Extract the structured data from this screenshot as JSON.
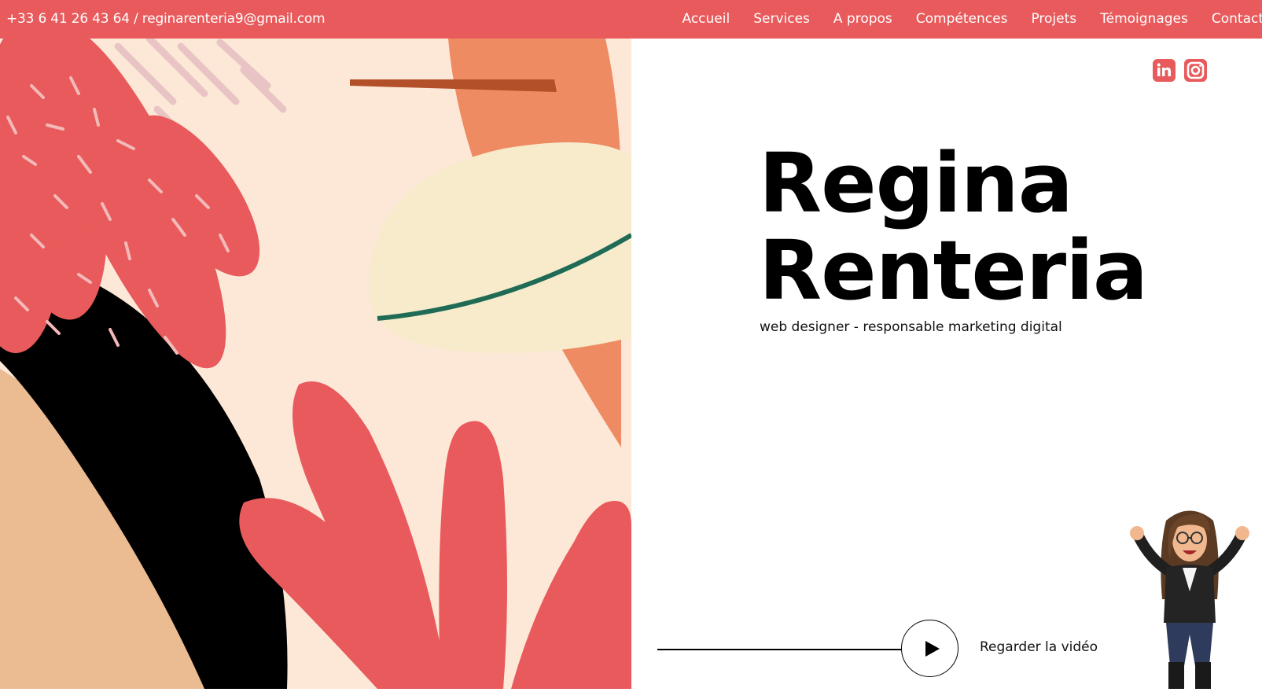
{
  "topbar": {
    "contact": "+33 6 41 26 43 64 / reginarenteria9@gmail.com",
    "nav": [
      "Accueil",
      "Services",
      "A propos",
      "Compétences",
      "Projets",
      "Témoignages",
      "Contact"
    ]
  },
  "social": {
    "linkedin_icon": "linkedin-icon",
    "instagram_icon": "instagram-icon"
  },
  "hero": {
    "name_line1": "Regina",
    "name_line2": "Renteria",
    "subtitle": "web designer - responsable marketing digital"
  },
  "video": {
    "label": "Regarder la vidéo"
  },
  "colors": {
    "accent": "#e85a5b",
    "cream": "#fde8d8",
    "black": "#000000"
  }
}
